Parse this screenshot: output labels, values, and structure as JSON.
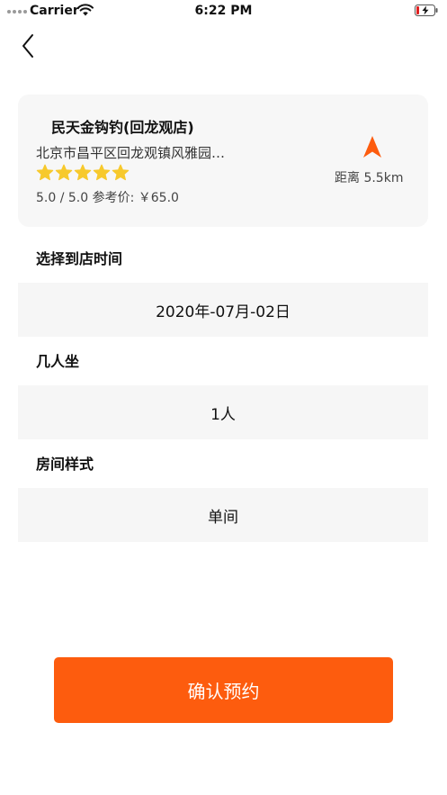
{
  "status_bar": {
    "carrier": "Carrier",
    "time": "6:22 PM",
    "signal_icon": "signal-dots-icon",
    "wifi_icon": "wifi-icon",
    "battery_icon": "battery-charging-icon"
  },
  "nav": {
    "back_icon": "chevron-left-icon"
  },
  "store": {
    "name": "民天金钩钓(回龙观店)",
    "address": "北京市昌平区回龙观镇风雅园…",
    "stars": 5,
    "rating_text": "5.0 / 5.0  参考价: ￥65.0",
    "nav_icon": "navigation-arrow-icon",
    "distance": "距离  5.5km"
  },
  "form": {
    "arrival_time_label": "选择到店时间",
    "arrival_time_value": "2020年-07月-02日",
    "party_size_label": "几人坐",
    "party_size_value": "1人",
    "room_style_label": "房间样式",
    "room_style_value": "单间"
  },
  "actions": {
    "confirm_label": "确认预约"
  },
  "colors": {
    "accent": "#fd5c0e",
    "star": "#f7c92c",
    "card_background": "#f7f7f7",
    "field_background": "#f6f6f6"
  }
}
